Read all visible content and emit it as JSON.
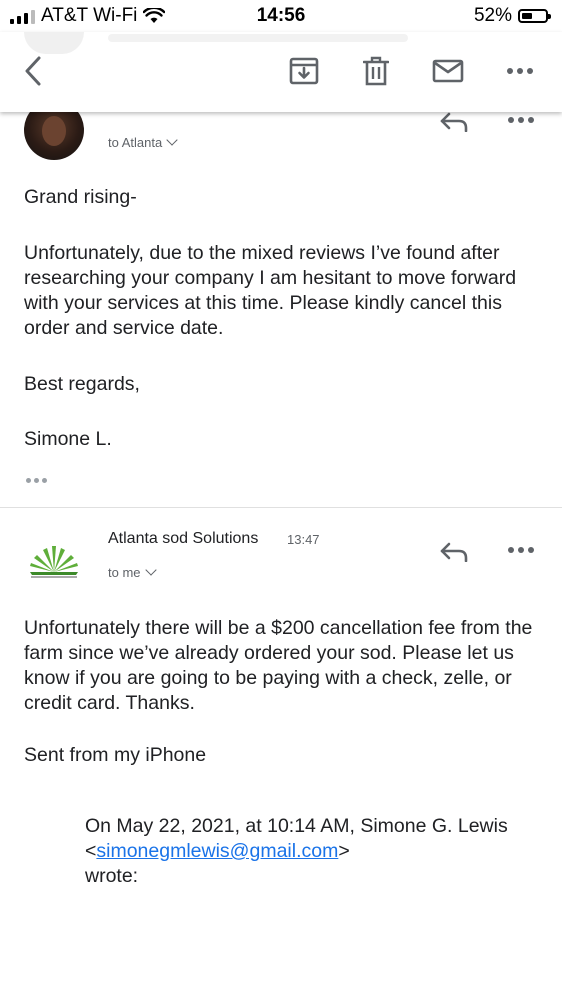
{
  "status_bar": {
    "carrier": "AT&T Wi-Fi",
    "time": "14:56",
    "battery": "52%",
    "battery_level": 0.52
  },
  "toolbar": {
    "back_icon": "chevron-left-icon",
    "archive_icon": "archive-icon",
    "delete_icon": "trash-icon",
    "mark_unread_icon": "mail-icon",
    "more_icon": "more-horizontal-icon"
  },
  "messages": [
    {
      "recipient_label": "to Atlanta",
      "paragraphs": [
        "Grand rising-",
        "Unfortunately, due to the mixed reviews I’ve found after researching your company I am hesitant to move forward with your services at this time. Please kindly cancel this order and service date.",
        "Best regards,",
        "Simone L."
      ]
    },
    {
      "sender": "Atlanta sod Solutions",
      "time": "13:47",
      "recipient_label": "to me",
      "paragraphs": [
        "Unfortunately there will be a $200 cancellation fee from the farm since we’ve already ordered your sod. Please let us know if you are going to be paying with a check, zelle, or credit card. Thanks.",
        "Sent from my iPhone"
      ],
      "quote": {
        "lead": "On May 22, 2021, at 10:14 AM, Simone G. Lewis <",
        "email": "simonegmlewis@gmail.com",
        "tail": ">",
        "wrote": "wrote:"
      }
    }
  ]
}
